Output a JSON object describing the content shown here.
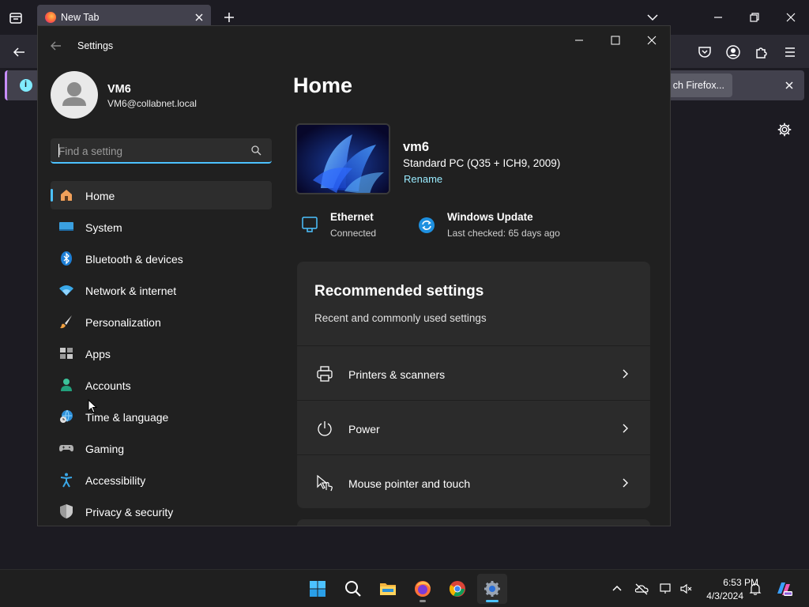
{
  "browser": {
    "tab": {
      "title": "New Tab"
    },
    "notification": {
      "button_label": "ch Firefox..."
    }
  },
  "settings": {
    "window_title": "Settings",
    "profile": {
      "name": "VM6",
      "email": "VM6@collabnet.local"
    },
    "search": {
      "placeholder": "Find a setting"
    },
    "nav": [
      {
        "label": "Home",
        "icon": "home-icon",
        "selected": true
      },
      {
        "label": "System",
        "icon": "system-icon"
      },
      {
        "label": "Bluetooth & devices",
        "icon": "bluetooth-icon"
      },
      {
        "label": "Network & internet",
        "icon": "wifi-icon"
      },
      {
        "label": "Personalization",
        "icon": "brush-icon"
      },
      {
        "label": "Apps",
        "icon": "apps-icon"
      },
      {
        "label": "Accounts",
        "icon": "accounts-icon"
      },
      {
        "label": "Time & language",
        "icon": "globe-clock-icon"
      },
      {
        "label": "Gaming",
        "icon": "gamepad-icon"
      },
      {
        "label": "Accessibility",
        "icon": "accessibility-icon"
      },
      {
        "label": "Privacy & security",
        "icon": "shield-icon"
      }
    ],
    "page_title": "Home",
    "device": {
      "name": "vm6",
      "model": "Standard PC (Q35 + ICH9, 2009)",
      "rename_label": "Rename"
    },
    "status": {
      "ethernet": {
        "title": "Ethernet",
        "status": "Connected"
      },
      "update": {
        "title": "Windows Update",
        "status": "Last checked: 65 days ago"
      }
    },
    "recommended": {
      "title": "Recommended settings",
      "subtitle": "Recent and commonly used settings",
      "items": [
        {
          "label": "Printers & scanners",
          "icon": "printer-icon"
        },
        {
          "label": "Power",
          "icon": "power-icon"
        },
        {
          "label": "Mouse pointer and touch",
          "icon": "pointer-touch-icon"
        }
      ]
    }
  },
  "taskbar": {
    "apps": [
      "start",
      "search",
      "file-explorer",
      "firefox",
      "chrome",
      "settings"
    ],
    "clock": {
      "time": "6:53 PM",
      "date": "4/3/2024"
    }
  },
  "colors": {
    "accent": "#4cc2ff",
    "link": "#99ebff",
    "window_bg": "#202020",
    "card_bg": "#2b2b2b"
  }
}
